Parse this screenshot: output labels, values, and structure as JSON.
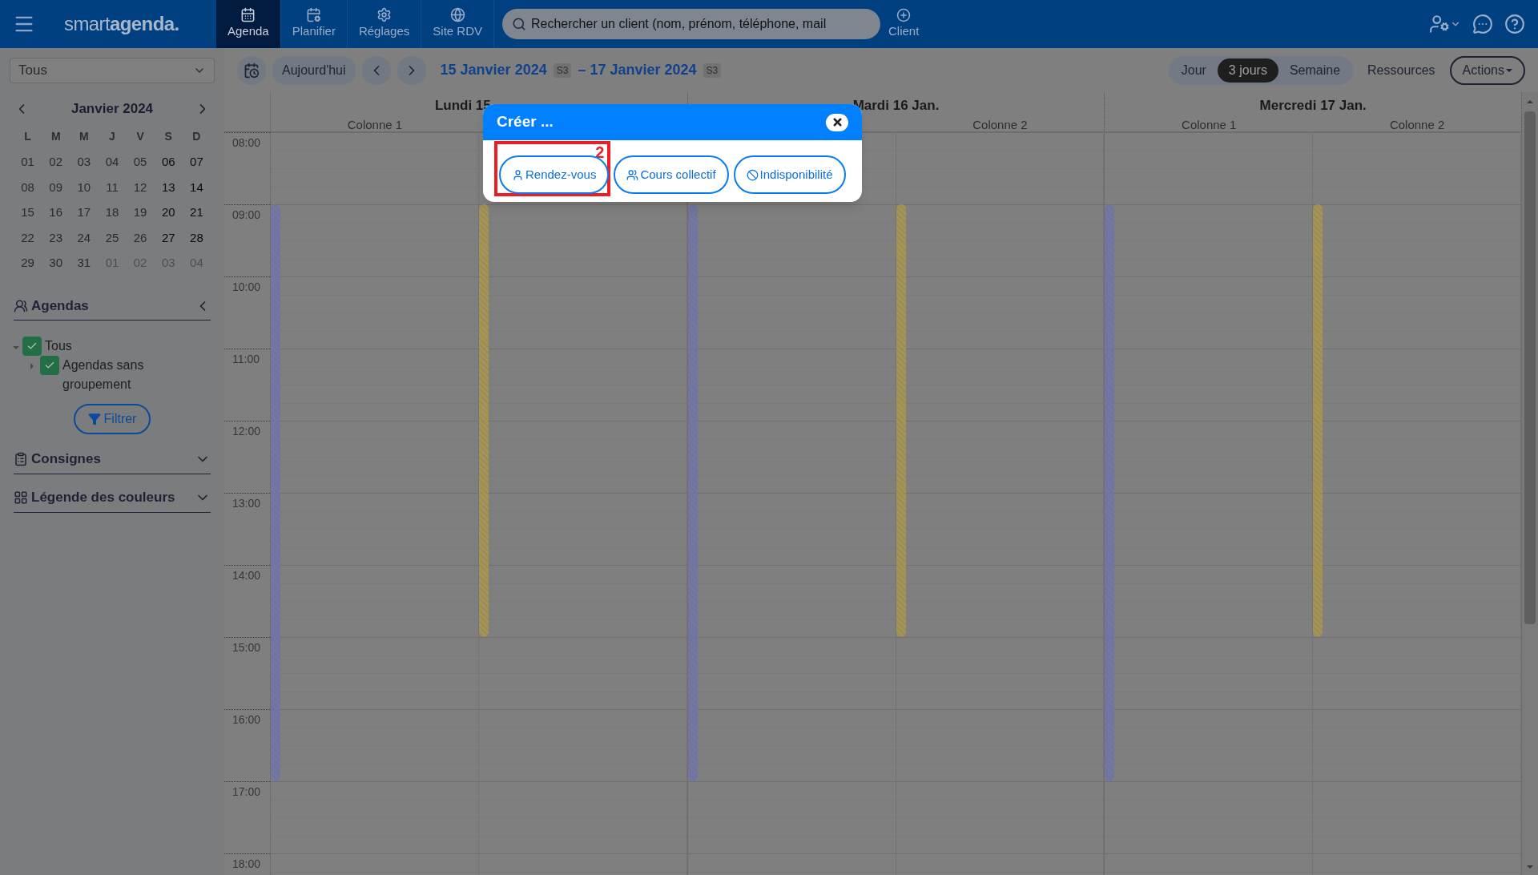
{
  "top_bar": {
    "logo": "smart**agenda.**",
    "nav_tabs": [
      {
        "label": "Agenda",
        "selected": true
      },
      {
        "label": "Planifier",
        "selected": false
      },
      {
        "label": "Réglages",
        "selected": false
      },
      {
        "label": "Site RDV",
        "selected": false
      }
    ],
    "search": {
      "placeholder": "Rechercher un client (nom, prénom, téléphone, mail"
    },
    "client_button": "Client"
  },
  "toolbar": {
    "today_button": "Aujourd'hui",
    "start_date": "15 Janvier 2024",
    "start_week": "S3",
    "end_date": "– 17 Janvier 2024",
    "end_week": "S3",
    "view_tabs": [
      {
        "label": "Jour",
        "selected": false
      },
      {
        "label": "3 jours",
        "selected": true
      },
      {
        "label": "Semaine",
        "selected": false
      }
    ],
    "resources_button": "Ressources",
    "actions_button": "Actions"
  },
  "sidebar": {
    "select": {
      "value": "Tous"
    },
    "mini_calendar": {
      "title": "Janvier 2024",
      "weekdays": [
        "L",
        "M",
        "M",
        "J",
        "V",
        "S",
        "D"
      ],
      "days": [
        {
          "label": "01",
          "muted": false
        },
        {
          "label": "02",
          "muted": false
        },
        {
          "label": "03",
          "muted": false
        },
        {
          "label": "04",
          "muted": false
        },
        {
          "label": "05",
          "muted": false
        },
        {
          "label": "06",
          "muted": false
        },
        {
          "label": "07",
          "muted": false
        },
        {
          "label": "08",
          "muted": false
        },
        {
          "label": "09",
          "muted": false
        },
        {
          "label": "10",
          "muted": false
        },
        {
          "label": "11",
          "muted": false
        },
        {
          "label": "12",
          "muted": false
        },
        {
          "label": "13",
          "muted": false
        },
        {
          "label": "14",
          "muted": false
        },
        {
          "label": "15",
          "muted": false
        },
        {
          "label": "16",
          "muted": false
        },
        {
          "label": "17",
          "muted": false
        },
        {
          "label": "18",
          "muted": false
        },
        {
          "label": "19",
          "muted": false
        },
        {
          "label": "20",
          "muted": false
        },
        {
          "label": "21",
          "muted": false
        },
        {
          "label": "22",
          "muted": false
        },
        {
          "label": "23",
          "muted": false
        },
        {
          "label": "24",
          "muted": false
        },
        {
          "label": "25",
          "muted": false
        },
        {
          "label": "26",
          "muted": false
        },
        {
          "label": "27",
          "muted": false
        },
        {
          "label": "28",
          "muted": false
        },
        {
          "label": "29",
          "muted": false
        },
        {
          "label": "30",
          "muted": false
        },
        {
          "label": "31",
          "muted": false
        },
        {
          "label": "01",
          "muted": true
        },
        {
          "label": "02",
          "muted": true
        },
        {
          "label": "03",
          "muted": true
        },
        {
          "label": "04",
          "muted": true
        }
      ]
    },
    "agendas": {
      "title": "Agendas",
      "tree": [
        {
          "label": "Tous",
          "checked": true,
          "expanded": true,
          "children": [
            {
              "label": "Agendas sans groupement",
              "checked": true,
              "expanded": false
            }
          ]
        }
      ]
    },
    "filter_button": "Filtrer",
    "sections": [
      {
        "title": "Consignes"
      },
      {
        "title": "Légende des couleurs"
      }
    ]
  },
  "calendar": {
    "hours": [
      "08:00",
      "09:00",
      "10:00",
      "11:00",
      "12:00",
      "13:00",
      "14:00",
      "15:00",
      "16:00",
      "17:00",
      "18:00"
    ],
    "days": [
      {
        "title": "Lundi 15",
        "columns": [
          {
            "label": "Colonne 1",
            "color": "#6f74a6"
          },
          {
            "color": "#a8944f"
          }
        ]
      },
      {
        "title": "Mardi 16 Jan.",
        "columns": [
          {
            "color": "#6f74a6"
          },
          {
            "label": "Colonne 2",
            "color": "#a8944f"
          }
        ]
      },
      {
        "title": "Mercredi 17 Jan.",
        "columns": [
          {
            "label": "Colonne 1",
            "color": "#6f74a6"
          },
          {
            "label": "Colonne 2",
            "color": "#a8944f"
          }
        ]
      }
    ]
  },
  "dialog": {
    "title": "Créer ...",
    "annotation": "2",
    "buttons": [
      {
        "label": "Rendez-vous",
        "highlighted": true
      },
      {
        "label": "Cours collectif",
        "highlighted": false
      },
      {
        "label": "Indisponibilité",
        "highlighted": false
      }
    ]
  }
}
